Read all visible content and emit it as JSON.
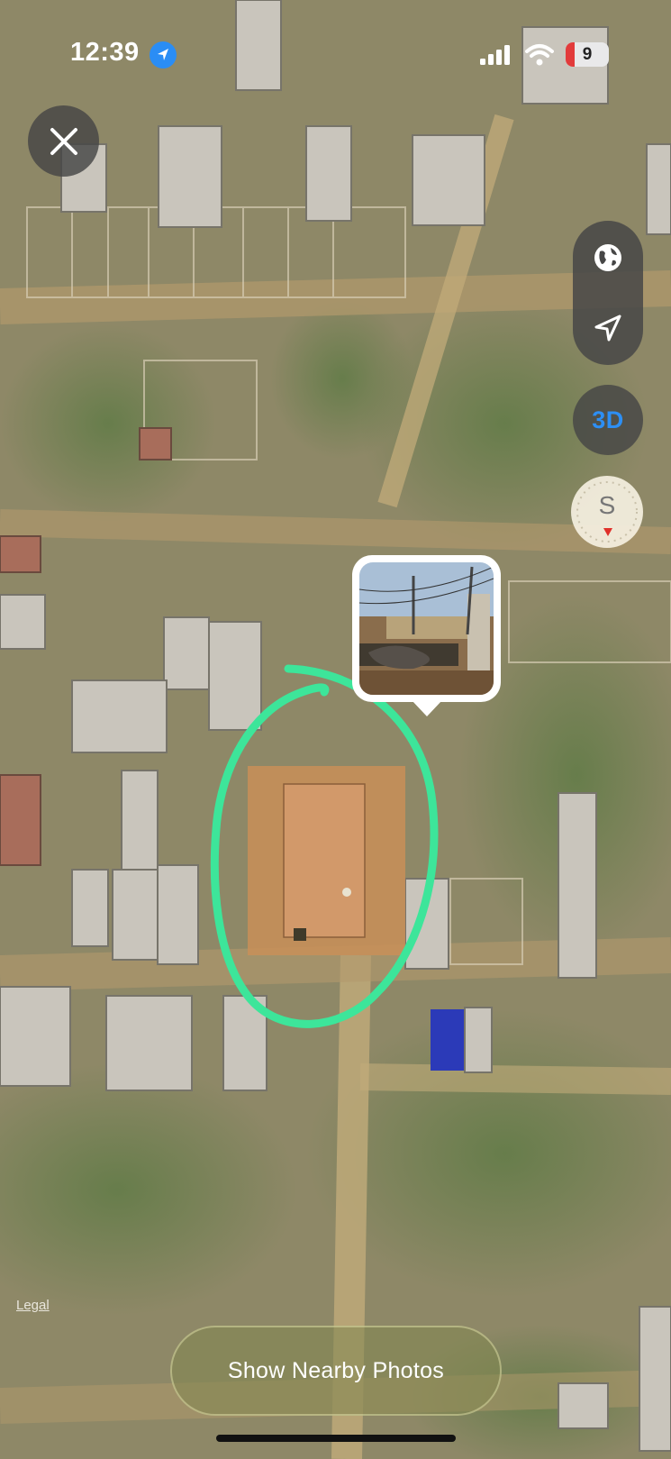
{
  "status_bar": {
    "time": "12:39",
    "battery_level": "9",
    "icons": [
      "location-arrow-icon",
      "cellular-signal-icon",
      "wifi-icon",
      "battery-charging-icon"
    ]
  },
  "map": {
    "view": "satellite",
    "annotation_color": "#3de59a",
    "legal_label": "Legal"
  },
  "controls": {
    "close_icon": "close-icon",
    "map_mode_icon": "globe-icon",
    "locate_icon": "location-arrow-icon",
    "three_d_label": "3D",
    "compass_label": "S"
  },
  "photo_pin": {
    "thumbnail": "street-photo"
  },
  "nearby_button": {
    "label": "Show Nearby Photos"
  },
  "colors": {
    "accent": "#2d8ff4",
    "battery_low": "#e23b3b"
  }
}
